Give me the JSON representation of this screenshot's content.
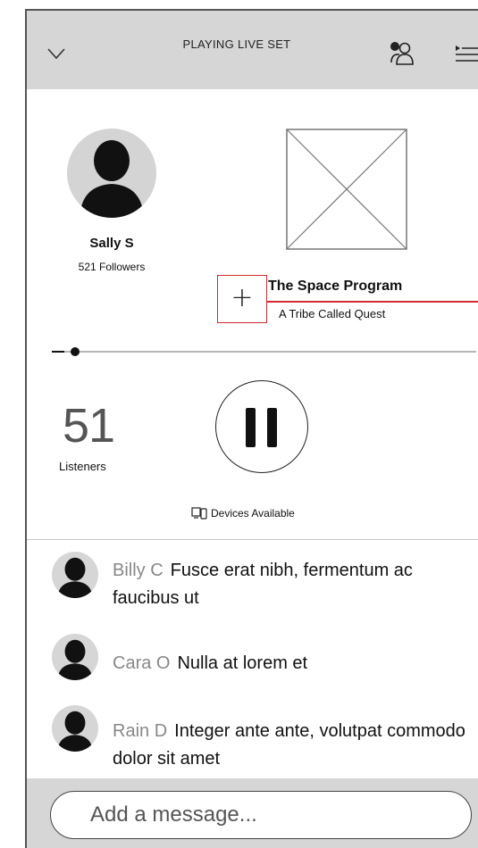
{
  "header": {
    "title": "PLAYING LIVE SET",
    "icons": [
      "chevron-down-icon",
      "people-icon",
      "queue-icon"
    ]
  },
  "host": {
    "name": "Sally S",
    "followers": "521 Followers"
  },
  "track": {
    "title": "The Space Program",
    "artist": "A Tribe Called Quest",
    "add_label": "+",
    "progress": 0.03
  },
  "listeners": {
    "count": "51",
    "label": "Listeners"
  },
  "devices": {
    "label": "Devices Available"
  },
  "comments": [
    {
      "user": "Billy C",
      "text": "Fusce erat nibh, fermentum ac faucibus ut"
    },
    {
      "user": "Cara O",
      "text": "Nulla at lorem et"
    },
    {
      "user": "Rain D",
      "text": "Integer ante ante, volutpat commodo dolor sit amet"
    }
  ],
  "composer": {
    "placeholder": "Add a message..."
  },
  "colors": {
    "header_bg": "#d6d6d6",
    "highlight": "#d12b34"
  }
}
